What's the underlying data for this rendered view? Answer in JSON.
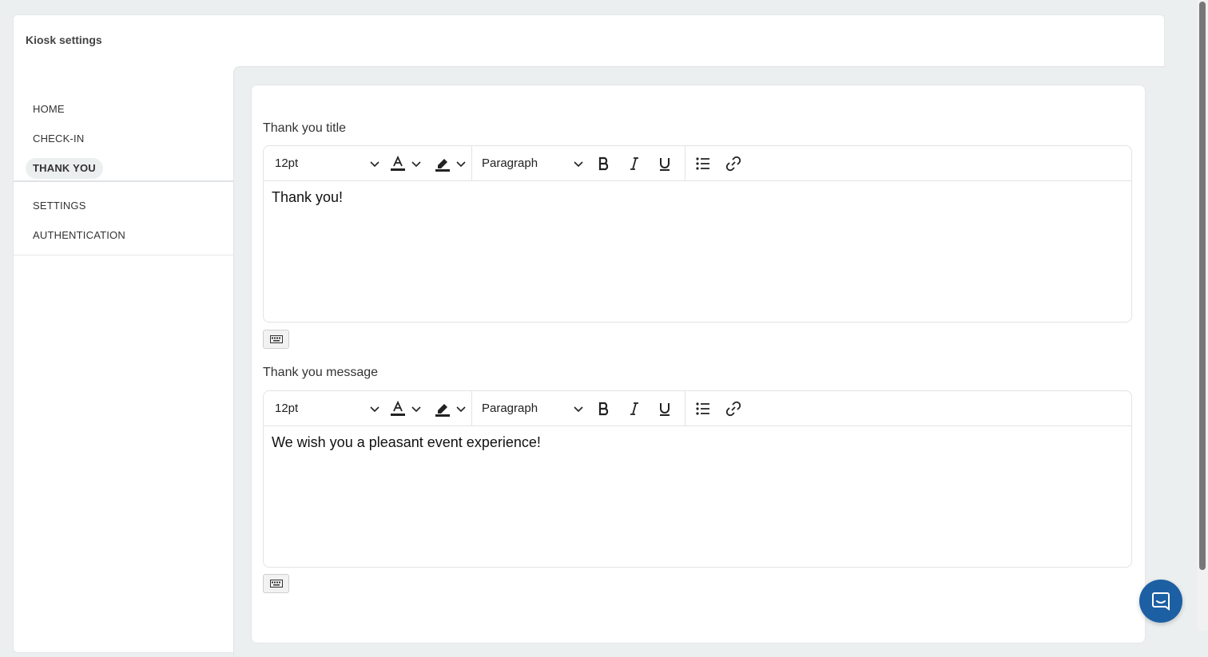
{
  "page": {
    "title": "Kiosk settings"
  },
  "sidebar": {
    "group1": [
      {
        "label": "HOME",
        "active": false
      },
      {
        "label": "CHECK-IN",
        "active": false
      },
      {
        "label": "THANK YOU",
        "active": true
      }
    ],
    "group2": [
      {
        "label": "SETTINGS",
        "active": false
      },
      {
        "label": "AUTHENTICATION",
        "active": false
      }
    ]
  },
  "fields": [
    {
      "label": "Thank you title",
      "toolbar": {
        "font_size": "12pt",
        "block_format": "Paragraph"
      },
      "content": "Thank you!"
    },
    {
      "label": "Thank you message",
      "toolbar": {
        "font_size": "12pt",
        "block_format": "Paragraph"
      },
      "content": "We wish you a pleasant event experience!"
    }
  ],
  "icons": {
    "text_color": "text-color-icon",
    "highlight": "highlight-icon",
    "bold": "bold-icon",
    "italic": "italic-icon",
    "underline": "underline-icon",
    "bullet_list": "bullet-list-icon",
    "link": "link-icon",
    "keyboard": "keyboard-icon",
    "chat": "chat-icon"
  },
  "colors": {
    "background": "#ebeff0",
    "active_nav_bg": "#ecefef",
    "chat_launcher": "#1d5fa3"
  }
}
